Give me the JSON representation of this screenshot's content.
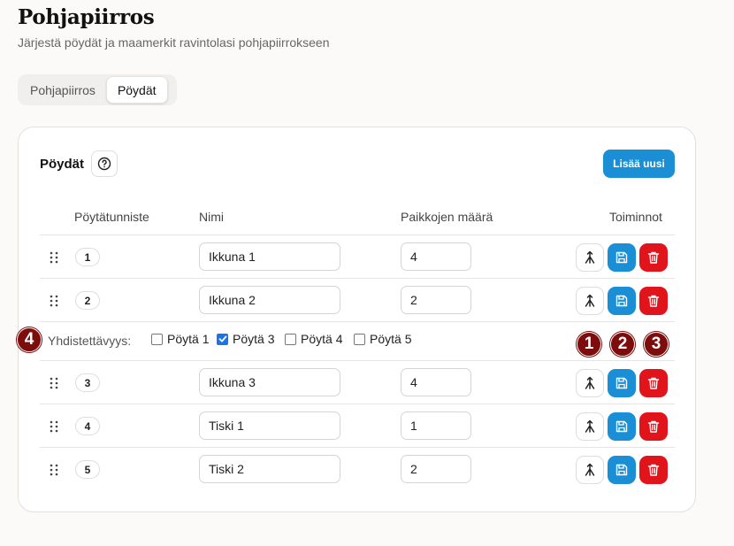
{
  "header": {
    "title": "Pohjapiirros",
    "subtitle": "Järjestä pöydät ja maamerkit ravintolasi pohjapiirrokseen"
  },
  "tabs": [
    {
      "label": "Pohjapiirros",
      "active": false
    },
    {
      "label": "Pöydät",
      "active": true
    }
  ],
  "card": {
    "title": "Pöydät",
    "add_label": "Lisää uusi",
    "columns": {
      "id": "Pöytätunniste",
      "name": "Nimi",
      "seats": "Paikkojen määrä",
      "actions": "Toiminnot"
    }
  },
  "rows": [
    {
      "id": "1",
      "name": "Ikkuna 1",
      "seats": "4"
    },
    {
      "id": "2",
      "name": "Ikkuna 2",
      "seats": "2"
    },
    {
      "id": "3",
      "name": "Ikkuna 3",
      "seats": "4"
    },
    {
      "id": "4",
      "name": "Tiski 1",
      "seats": "1"
    },
    {
      "id": "5",
      "name": "Tiski 2",
      "seats": "2"
    }
  ],
  "merge": {
    "label": "Yhdistettävyys:",
    "options": [
      {
        "label": "Pöytä 1",
        "checked": false
      },
      {
        "label": "Pöytä 3",
        "checked": true
      },
      {
        "label": "Pöytä 4",
        "checked": false
      },
      {
        "label": "Pöytä 5",
        "checked": false
      }
    ]
  },
  "markers": [
    "4",
    "1",
    "2",
    "3"
  ],
  "colors": {
    "primary": "#1a8fd6",
    "danger": "#e2141b",
    "marker": "#7d0c0c",
    "checkbox": "#1a73e8"
  },
  "icons": {
    "merge": "merge-icon",
    "save": "save-icon",
    "delete": "trash-icon",
    "drag": "drag-handle-icon",
    "help": "help-circle-icon"
  }
}
